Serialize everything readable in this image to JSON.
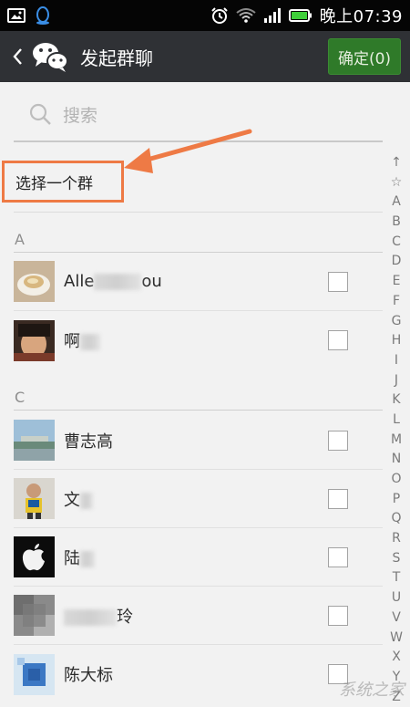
{
  "status_bar": {
    "time": "晚上07:39",
    "icons": [
      "image-icon",
      "qq-penguin-icon",
      "alarm-icon",
      "wifi-icon",
      "signal-icon",
      "battery-icon"
    ]
  },
  "header": {
    "title": "发起群聊",
    "confirm_label": "确定(0)"
  },
  "search": {
    "placeholder": "搜索"
  },
  "select_group_label": "选择一个群",
  "sections": [
    {
      "letter": "A",
      "contacts": [
        {
          "name_visible_start": "Alle",
          "name_visible_end": "ou"
        },
        {
          "name_visible_start": "啊",
          "name_visible_end": ""
        }
      ]
    },
    {
      "letter": "C",
      "contacts": [
        {
          "name_visible_start": "曹志高",
          "name_visible_end": ""
        },
        {
          "name_visible_start": "文",
          "name_visible_end": ""
        },
        {
          "name_visible_start": "陆",
          "name_visible_end": ""
        },
        {
          "name_visible_start": "",
          "name_visible_end": "玲"
        },
        {
          "name_visible_start": "陈大标",
          "name_visible_end": ""
        }
      ]
    }
  ],
  "alphabet_index": [
    "↑",
    "☆",
    "A",
    "B",
    "C",
    "D",
    "E",
    "F",
    "G",
    "H",
    "I",
    "J",
    "K",
    "L",
    "M",
    "N",
    "O",
    "P",
    "Q",
    "R",
    "S",
    "T",
    "U",
    "V",
    "W",
    "X",
    "Y",
    "Z"
  ],
  "watermark": "系统之家",
  "colors": {
    "titlebar_bg": "#2f3135",
    "confirm_bg": "#2f7a29",
    "annotation": "#ee7a45"
  }
}
